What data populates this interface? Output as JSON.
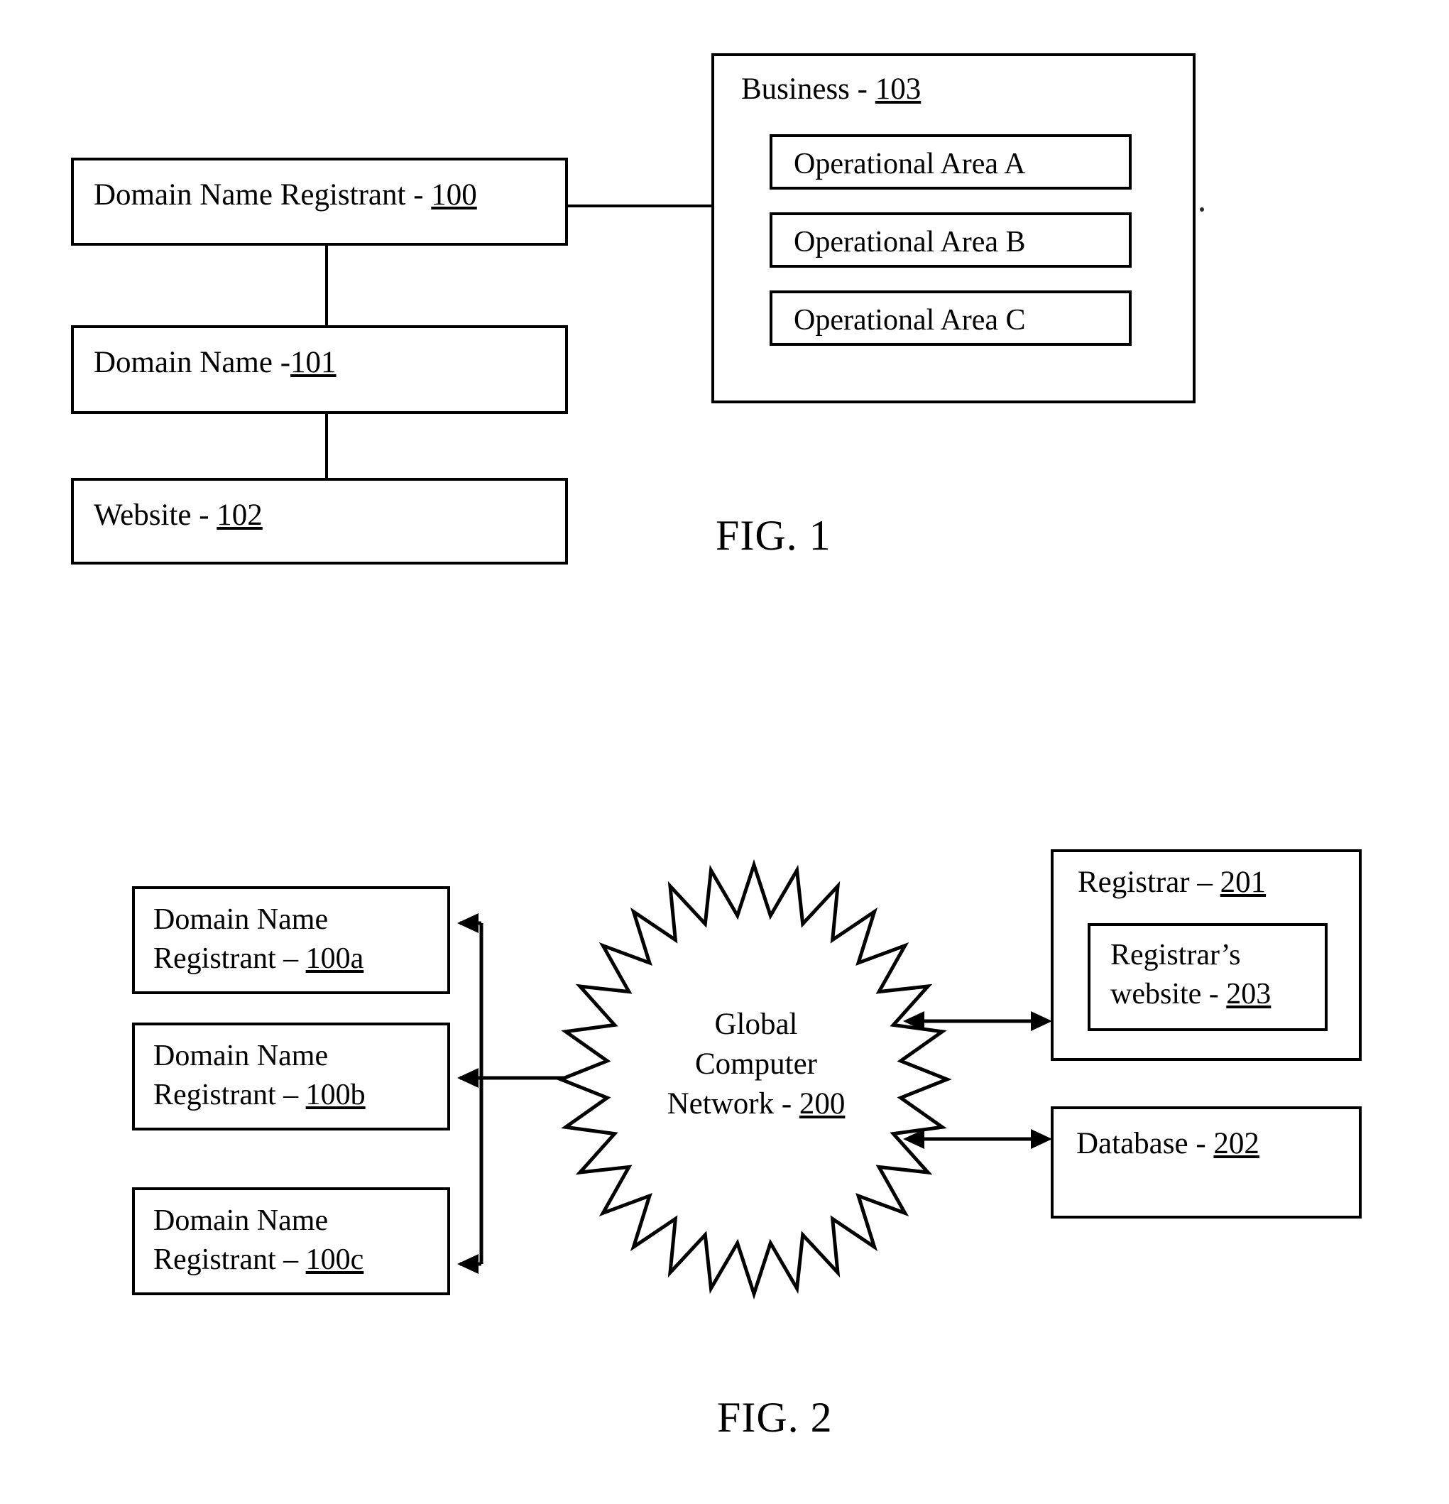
{
  "figure1": {
    "caption": "FIG. 1",
    "registrant": {
      "text": "Domain Name Registrant - ",
      "ref": "100"
    },
    "domain_name": {
      "text": "Domain Name -",
      "ref": "101"
    },
    "website": {
      "text": "Website - ",
      "ref": "102"
    },
    "business": {
      "text": "Business - ",
      "ref": "103",
      "operational_areas": [
        "Operational Area A",
        "Operational Area B",
        "Operational Area C"
      ]
    }
  },
  "figure2": {
    "caption": "FIG. 2",
    "registrants": [
      {
        "line1": "Domain Name",
        "line2": "Registrant – ",
        "ref": "100a"
      },
      {
        "line1": "Domain Name",
        "line2": "Registrant – ",
        "ref": "100b"
      },
      {
        "line1": "Domain Name",
        "line2": "Registrant – ",
        "ref": "100c"
      }
    ],
    "network": {
      "line1": "Global",
      "line2": "Computer",
      "line3": "Network - ",
      "ref": "200",
      "points": 28
    },
    "registrar": {
      "text": "Registrar – ",
      "ref": "201",
      "website": {
        "line1": "Registrar’s",
        "line2": "website - ",
        "ref": "203"
      }
    },
    "database": {
      "text": "Database - ",
      "ref": "202"
    }
  },
  "colors": {
    "ink": "#000000",
    "paper": "#ffffff"
  }
}
